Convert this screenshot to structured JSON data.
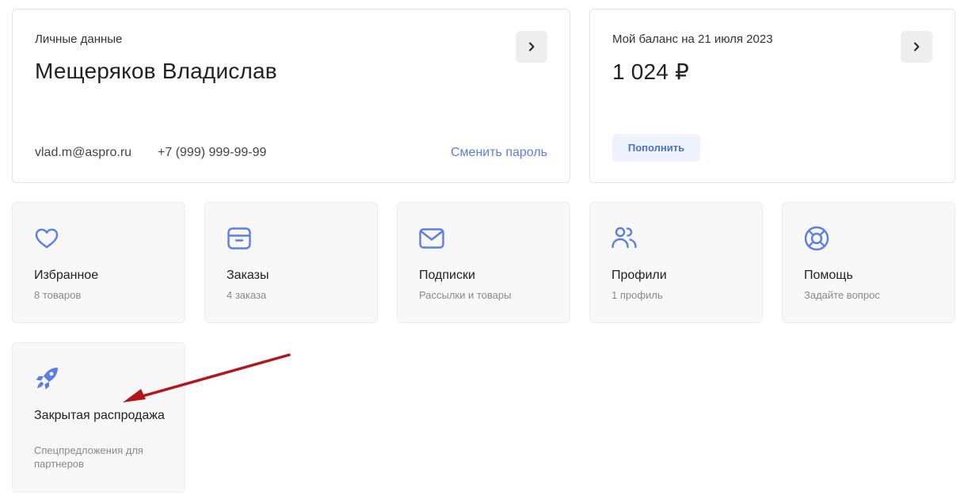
{
  "personal": {
    "caption": "Личные данные",
    "name": "Мещеряков Владислав",
    "email": "vlad.m@aspro.ru",
    "phone": "+7 (999) 999-99-99",
    "change_password": "Сменить пароль",
    "arrow_icon": "chevron-right-icon"
  },
  "balance": {
    "caption": "Мой баланс на 21 июля 2023",
    "amount": "1 024 ₽",
    "topup_label": "Пополнить",
    "arrow_icon": "chevron-right-icon"
  },
  "tiles": [
    {
      "title": "Избранное",
      "subtitle": "8 товаров",
      "icon": "heart-icon"
    },
    {
      "title": "Заказы",
      "subtitle": "4 заказа",
      "icon": "archive-box-icon"
    },
    {
      "title": "Подписки",
      "subtitle": "Рассылки и товары",
      "icon": "mail-icon"
    },
    {
      "title": "Профили",
      "subtitle": "1 профиль",
      "icon": "users-icon"
    },
    {
      "title": "Помощь",
      "subtitle": "Задайте вопрос",
      "icon": "lifebuoy-icon"
    },
    {
      "title": "Закрытая распродажа",
      "subtitle": "Спецпредложения для партнеров",
      "icon": "rocket-icon"
    }
  ],
  "colors": {
    "accent": "#5b7ee5",
    "annotation_arrow": "#b3151c",
    "tile_bg": "#f7f7f7"
  }
}
